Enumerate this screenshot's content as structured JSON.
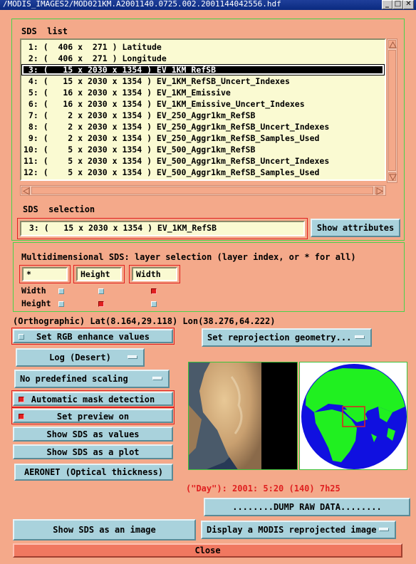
{
  "window": {
    "title": "/MODIS_IMAGES2/MOD021KM.A2001140.0725.002.2001144042556.hdf"
  },
  "sds_list": {
    "label": "SDS  list",
    "items": [
      " 1: (  406 x  271 ) Latitude",
      " 2: (  406 x  271 ) Longitude",
      " 3: (   15 x 2030 x 1354 ) EV_1KM_RefSB",
      " 4: (   15 x 2030 x 1354 ) EV_1KM_RefSB_Uncert_Indexes",
      " 5: (   16 x 2030 x 1354 ) EV_1KM_Emissive",
      " 6: (   16 x 2030 x 1354 ) EV_1KM_Emissive_Uncert_Indexes",
      " 7: (    2 x 2030 x 1354 ) EV_250_Aggr1km_RefSB",
      " 8: (    2 x 2030 x 1354 ) EV_250_Aggr1km_RefSB_Uncert_Indexes",
      " 9: (    2 x 2030 x 1354 ) EV_250_Aggr1km_RefSB_Samples_Used",
      "10: (    5 x 2030 x 1354 ) EV_500_Aggr1km_RefSB",
      "11: (    5 x 2030 x 1354 ) EV_500_Aggr1km_RefSB_Uncert_Indexes",
      "12: (    5 x 2030 x 1354 ) EV_500_Aggr1km_RefSB_Samples_Used"
    ],
    "selected_index": 2
  },
  "sds_selection": {
    "label": "SDS  selection",
    "value": " 3: (   15 x 2030 x 1354 ) EV_1KM_RefSB",
    "show_attributes_label": "Show attributes"
  },
  "multidim": {
    "label": "Multidimensional SDS: layer selection (layer index, or * for all)",
    "fields": [
      "*",
      "Height",
      "Width"
    ],
    "row_labels": [
      "Width",
      "Height"
    ],
    "toggles": [
      [
        false,
        false,
        true
      ],
      [
        false,
        true,
        false
      ]
    ]
  },
  "status": {
    "projection": "(Orthographic) Lat(8.164,29.118) Lon(38.276,64.222)",
    "day": "(\"Day\"): 2001: 5:20 (140) 7h25"
  },
  "controls": {
    "rgb_enhance": "Set RGB enhance values",
    "reprojection": "Set reprojection geometry...",
    "log": "Log (Desert)",
    "scaling": "No predefined scaling",
    "auto_mask": "Automatic mask detection",
    "preview": "Set preview on",
    "show_values": "Show SDS as values",
    "show_plot": "Show SDS as a plot",
    "aeronet": "AERONET (Optical thickness)",
    "dump_raw": "........DUMP RAW DATA........",
    "show_image": "Show SDS as an image",
    "display_reprojected": "Display a MODIS reprojected image",
    "close": "Close"
  },
  "colors": {
    "background": "#f4a98a",
    "button": "#a9d2dc",
    "list_bg": "#fafad2",
    "frame_green": "#4ad24a",
    "red_outline": "#e02020",
    "ocean_blue": "#1010e0",
    "land_green": "#20f020",
    "close_bg": "#f07860"
  }
}
